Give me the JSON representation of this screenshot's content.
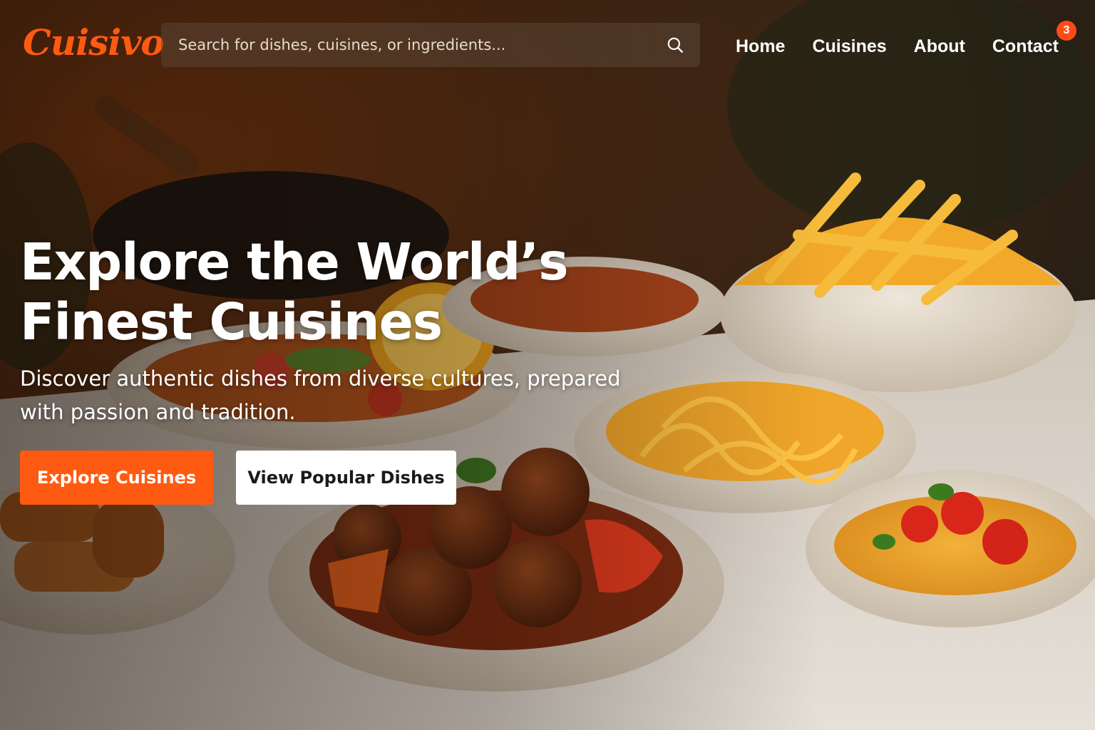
{
  "brand": {
    "logo_text": "Cuisivo",
    "accent_color": "#ff5a12"
  },
  "search": {
    "placeholder": "Search for dishes, cuisines, or ingredients...",
    "icon": "search-icon"
  },
  "nav": {
    "items": [
      {
        "label": "Home"
      },
      {
        "label": "Cuisines"
      },
      {
        "label": "About"
      },
      {
        "label": "Contact"
      }
    ],
    "contact_badge": "3"
  },
  "hero": {
    "title": "Explore the World’s Finest Cuisines",
    "subtitle": "Discover authentic dishes from diverse cultures, prepared with passion and tradition.",
    "primary_cta": "Explore Cuisines",
    "secondary_cta": "View Popular Dishes"
  },
  "colors": {
    "badge": "#ff4b14",
    "primary_button": "#ff5a12",
    "secondary_button": "#ffffff"
  }
}
